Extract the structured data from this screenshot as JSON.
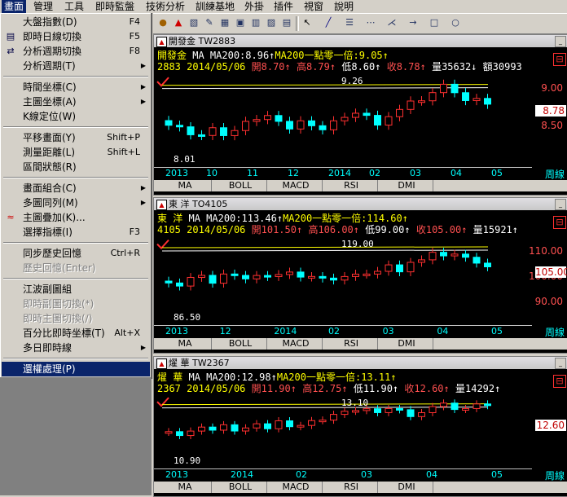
{
  "menubar": [
    {
      "label": "畫面",
      "active": true
    },
    {
      "label": "管理",
      "active": false
    },
    {
      "label": "工具",
      "active": false
    },
    {
      "label": "即時監盤",
      "active": false
    },
    {
      "label": "技術分析",
      "active": false
    },
    {
      "label": "訓練基地",
      "active": false
    },
    {
      "label": "外掛",
      "active": false
    },
    {
      "label": "插件",
      "active": false
    },
    {
      "label": "視窗",
      "active": false
    },
    {
      "label": "說明",
      "active": false
    }
  ],
  "dropdown": [
    {
      "type": "item",
      "label": "大盤指數(D)",
      "shortcut": "F4",
      "icon": "",
      "disabled": false,
      "submenu": false
    },
    {
      "type": "item",
      "label": "即時日線切換",
      "shortcut": "F5",
      "icon": "chart-icon",
      "disabled": false,
      "submenu": false
    },
    {
      "type": "item",
      "label": "分析週期切換",
      "shortcut": "F8",
      "icon": "switch-icon",
      "disabled": false,
      "submenu": false
    },
    {
      "type": "item",
      "label": "分析週期(T)",
      "shortcut": "",
      "icon": "",
      "disabled": false,
      "submenu": true
    },
    {
      "type": "sep"
    },
    {
      "type": "item",
      "label": "時間坐標(C)",
      "shortcut": "",
      "icon": "",
      "disabled": false,
      "submenu": true
    },
    {
      "type": "item",
      "label": "主圖坐標(A)",
      "shortcut": "",
      "icon": "",
      "disabled": false,
      "submenu": true
    },
    {
      "type": "item",
      "label": "K線定位(W)",
      "shortcut": "",
      "icon": "",
      "disabled": false,
      "submenu": false
    },
    {
      "type": "sep"
    },
    {
      "type": "item",
      "label": "平移畫面(Y)",
      "shortcut": "Shift+P",
      "icon": "",
      "disabled": false,
      "submenu": false
    },
    {
      "type": "item",
      "label": "測量距離(L)",
      "shortcut": "Shift+L",
      "icon": "",
      "disabled": false,
      "submenu": false
    },
    {
      "type": "item",
      "label": "區間狀態(R)",
      "shortcut": "",
      "icon": "",
      "disabled": false,
      "submenu": false
    },
    {
      "type": "sep"
    },
    {
      "type": "item",
      "label": "畫面組合(C)",
      "shortcut": "",
      "icon": "",
      "disabled": false,
      "submenu": true
    },
    {
      "type": "item",
      "label": "多圖同列(M)",
      "shortcut": "",
      "icon": "",
      "disabled": false,
      "submenu": true
    },
    {
      "type": "item",
      "label": "主圖疊加(K)...",
      "shortcut": "",
      "icon": "overlay-icon",
      "disabled": false,
      "submenu": false
    },
    {
      "type": "item",
      "label": "選擇指標(I)",
      "shortcut": "F3",
      "icon": "",
      "disabled": false,
      "submenu": false
    },
    {
      "type": "sep"
    },
    {
      "type": "item",
      "label": "同步歷史回憶",
      "shortcut": "Ctrl+R",
      "icon": "",
      "disabled": false,
      "submenu": false
    },
    {
      "type": "item",
      "label": "歷史回憶(Enter)",
      "shortcut": "",
      "icon": "",
      "disabled": true,
      "submenu": false
    },
    {
      "type": "sep"
    },
    {
      "type": "item",
      "label": "江波副圖組",
      "shortcut": "",
      "icon": "",
      "disabled": false,
      "submenu": false
    },
    {
      "type": "item",
      "label": "即時副圖切換(*)",
      "shortcut": "",
      "icon": "",
      "disabled": true,
      "submenu": false
    },
    {
      "type": "item",
      "label": "即時主圖切換(/)",
      "shortcut": "",
      "icon": "",
      "disabled": true,
      "submenu": false
    },
    {
      "type": "item",
      "label": "百分比即時坐標(T)",
      "shortcut": "Alt+X",
      "icon": "",
      "disabled": false,
      "submenu": false
    },
    {
      "type": "item",
      "label": "多日即時線",
      "shortcut": "",
      "icon": "",
      "disabled": false,
      "submenu": true
    },
    {
      "type": "sep"
    },
    {
      "type": "item",
      "label": "還權處理(P)",
      "shortcut": "",
      "icon": "",
      "disabled": false,
      "submenu": false,
      "selected": true
    }
  ],
  "toolbar_icons": [
    "bomb-icon",
    "alarm-icon",
    "ruler-icon",
    "pen-icon",
    "grid-icon",
    "window-icon",
    "calc-icon",
    "image-icon",
    "chart-icon",
    "cursor-icon",
    "line-icon",
    "fib-icon",
    "channel-icon",
    "fan-icon",
    "arrow-icon",
    "rect-icon",
    "ellipse-icon"
  ],
  "windows": [
    {
      "title": "開發金 TW2883",
      "info1": {
        "name": "開發金",
        "ma": "MA MA200:8.96↑",
        "ma2": "MA200一點零一倍:9.05↑"
      },
      "info2": {
        "code": "2883",
        "date": "2014/05/06",
        "open": "開8.70↑",
        "high": "高8.79↑",
        "low": "低8.60↑",
        "close": "收8.78↑",
        "vol": "量35632↓",
        "amt": "額30993"
      },
      "price_tag": "8.78",
      "ylabels": [
        "9.00",
        "8.50"
      ],
      "hi_label": "9.26",
      "lo_label": "8.01",
      "xlabels": [
        "2013",
        "10",
        "11",
        "12",
        "2014",
        "02",
        "03",
        "04",
        "05"
      ],
      "period": "周線",
      "indicators": [
        "MA",
        "BOLL",
        "MACD",
        "RSI",
        "DMI"
      ]
    },
    {
      "title": "東 洋 TO4105",
      "info1": {
        "name": "東 洋",
        "ma": "MA MA200:113.46↑",
        "ma2": "MA200一點零一倍:114.60↑"
      },
      "info2": {
        "code": "4105",
        "date": "2014/05/06",
        "open": "開101.50↑",
        "high": "高106.00↑",
        "low": "低99.00↑",
        "close": "收105.00↑",
        "vol": "量15921↑",
        "amt": ""
      },
      "price_tag": "105.00",
      "ylabels": [
        "110.00",
        "100.00",
        "90.00"
      ],
      "hi_label": "119.00",
      "lo_label": "86.50",
      "xlabels": [
        "2013",
        "12",
        "2014",
        "02",
        "03",
        "04",
        "05"
      ],
      "period": "周線",
      "indicators": [
        "MA",
        "BOLL",
        "MACD",
        "RSI",
        "DMI"
      ]
    },
    {
      "title": "燿 華 TW2367",
      "info1": {
        "name": "燿 華",
        "ma": "MA MA200:12.98↑",
        "ma2": "MA200一點零一倍:13.11↑"
      },
      "info2": {
        "code": "2367",
        "date": "2014/05/06",
        "open": "開11.90↑",
        "high": "高12.75↑",
        "low": "低11.90↑",
        "close": "收12.60↑",
        "vol": "量14292↑",
        "amt": ""
      },
      "price_tag": "12.60",
      "ylabels": [],
      "hi_label": "13.10",
      "lo_label": "10.90",
      "xlabels": [
        "2013",
        "2014",
        "02",
        "03",
        "04",
        "05"
      ],
      "period": "周線",
      "indicators": [
        "MA",
        "BOLL",
        "MACD",
        "RSI",
        "DMI"
      ]
    }
  ],
  "colors": {
    "up": "#ff3030",
    "down": "#00ffff",
    "ma": "#ffff00",
    "ma2": "#ffffff",
    "bg": "#000000"
  }
}
